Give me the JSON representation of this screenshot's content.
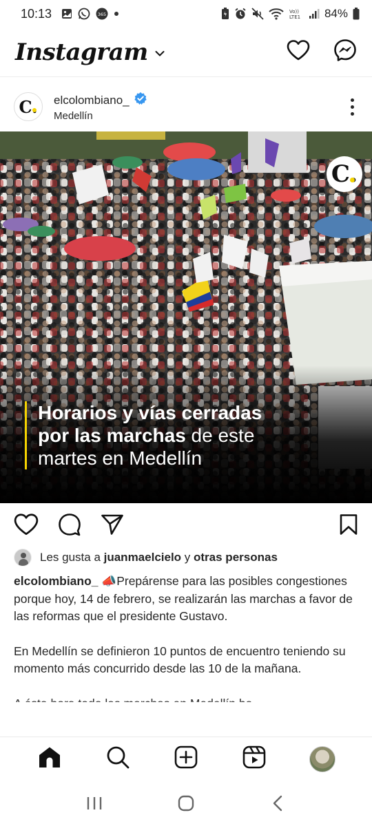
{
  "status_bar": {
    "time": "10:13",
    "battery_percent": "84%",
    "signal_label": "Vo)) LTE1",
    "notif_icons": [
      "gallery-icon",
      "whatsapp-icon",
      "office365-icon",
      "dot-icon"
    ],
    "system_icons": [
      "battery-saver-icon",
      "alarm-icon",
      "mute-icon",
      "wifi-icon",
      "signal-icon",
      "battery-icon"
    ]
  },
  "header": {
    "brand": "Instagram",
    "icons": [
      "chevron-down-icon",
      "heart-icon",
      "messenger-icon"
    ]
  },
  "post": {
    "avatar_letter": "C.",
    "username": "elcolombiano_",
    "verified": true,
    "location": "Medellín",
    "image": {
      "logo_letter": "C.",
      "caption_lines": [
        {
          "bold": "Horarios y vías cerradas",
          "regular": ""
        },
        {
          "bold": "por las marchas",
          "regular": " de este"
        },
        {
          "bold": "",
          "regular": "martes en Medellín"
        }
      ]
    },
    "likes": {
      "prefix": "Les gusta a ",
      "user": "juanmaelcielo",
      "middle": " y ",
      "others": "otras personas"
    },
    "caption": {
      "username": "elcolombiano_",
      "emoji": "📣",
      "paragraph1": "Prepárense para las posibles congestiones porque hoy, 14 de febrero, se realizarán las marchas a favor de las reformas que el presidente Gustavo.",
      "paragraph2": "En Medellín se definieron 10 puntos de encuentro teniendo su momento más concurrido desde las 10 de la mañana.",
      "paragraph3_partial": "A ésta hora todo las marchas en Medellín ha"
    }
  },
  "bottom_nav": {
    "items": [
      "home-icon",
      "search-icon",
      "create-icon",
      "reels-icon",
      "profile-avatar"
    ]
  },
  "system_nav": {
    "items": [
      "recents-icon",
      "home-circle-icon",
      "back-icon"
    ]
  },
  "colors": {
    "accent_yellow": "#f5d400",
    "verified_blue": "#3897f0",
    "text": "#262626"
  }
}
